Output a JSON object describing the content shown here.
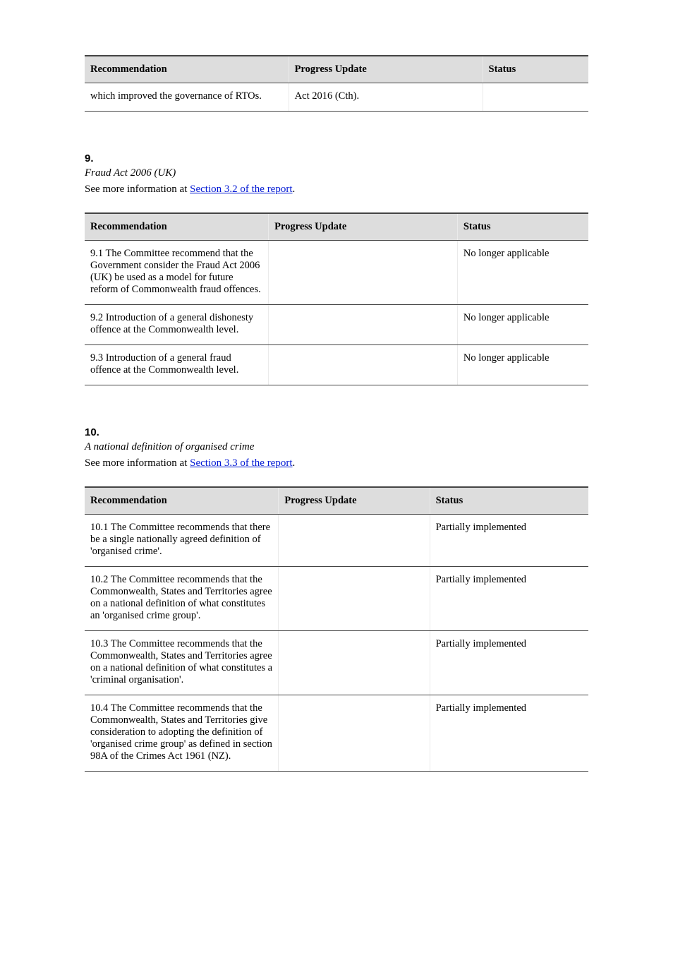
{
  "table1": {
    "headers": [
      "Recommendation",
      "Progress Update",
      "Status"
    ],
    "rows": [
      {
        "c1": "which improved the governance of RTOs.",
        "c2": "Act 2016 (Cth).",
        "c3": ""
      }
    ]
  },
  "section1": {
    "num": "9.",
    "title": "Fraud Act 2006 (UK)",
    "see_prefix": "See more information at ",
    "see_link": "Section 3.2 of the report",
    "see_suffix": "."
  },
  "table2": {
    "headers": [
      "Recommendation",
      "Progress Update",
      "Status"
    ],
    "rows": [
      {
        "c1": "9.1 The Committee recommend that the Government consider the Fraud Act 2006 (UK) be used as a model for future reform of Commonwealth fraud offences.",
        "c2": "",
        "c3": "No longer applicable"
      },
      {
        "c1": "9.2 Introduction of a general dishonesty offence at the Commonwealth level.",
        "c2": "",
        "c3": "No longer applicable"
      },
      {
        "c1": "9.3 Introduction of a general fraud offence at the Commonwealth level.",
        "c2": "",
        "c3": "No longer applicable"
      }
    ]
  },
  "section2": {
    "num": "10.",
    "title": "A national definition of organised crime",
    "see_prefix": "See more information at ",
    "see_link": "Section 3.3 of the report",
    "see_suffix": "."
  },
  "table3": {
    "headers": [
      "Recommendation",
      "Progress Update",
      "Status"
    ],
    "rows": [
      {
        "c1": "10.1 The Committee recommends that there be a single nationally agreed definition of 'organised crime'.",
        "c2": "",
        "c3": "Partially implemented"
      },
      {
        "c1": "10.2 The Committee recommends that the Commonwealth, States and Territories agree on a national definition of what constitutes an 'organised crime group'.",
        "c2": "",
        "c3": "Partially implemented"
      },
      {
        "c1": "10.3 The Committee recommends that the Commonwealth, States and Territories agree on a national definition of what constitutes a 'criminal organisation'.",
        "c2": "",
        "c3": "Partially implemented"
      },
      {
        "c1": "10.4 The Committee recommends that the Commonwealth, States and Territories give consideration to adopting the definition of 'organised crime group' as defined in section 98A of the Crimes Act 1961 (NZ).",
        "c2": "",
        "c3": "Partially implemented"
      }
    ]
  }
}
